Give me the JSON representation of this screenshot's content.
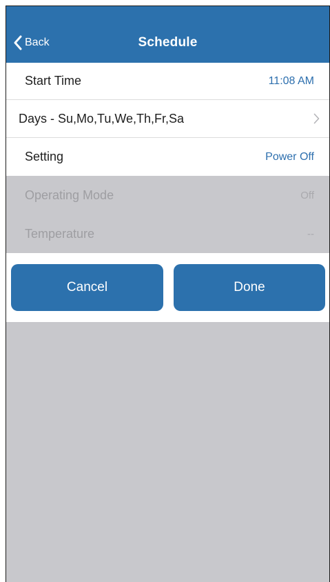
{
  "navbar": {
    "back_label": "Back",
    "title": "Schedule"
  },
  "rows": {
    "start_time": {
      "label": "Start Time",
      "value": "11:08 AM"
    },
    "days": {
      "label": "Days - Su,Mo,Tu,We,Th,Fr,Sa"
    },
    "setting": {
      "label": "Setting",
      "value": "Power Off"
    },
    "operating_mode": {
      "label": "Operating Mode",
      "value": "Off"
    },
    "temperature": {
      "label": "Temperature",
      "value": "--"
    }
  },
  "buttons": {
    "cancel_label": "Cancel",
    "done_label": "Done"
  },
  "colors": {
    "accent": "#2c71ad",
    "disabled_background": "#c8c8cc",
    "value_text": "#2d6fae"
  },
  "icons": {
    "back": "chevron-left-icon",
    "days_disclosure": "chevron-right-icon"
  }
}
